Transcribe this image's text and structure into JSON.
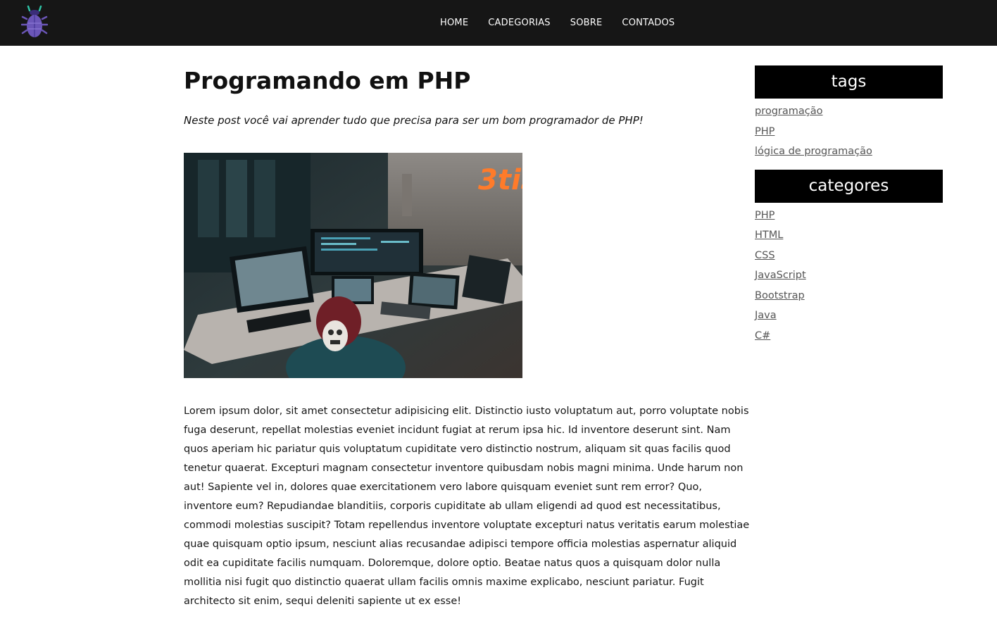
{
  "nav": {
    "logo_icon": "bug-icon",
    "items": [
      {
        "label": "HOME"
      },
      {
        "label": "CADEGORIAS"
      },
      {
        "label": "SOBRE"
      },
      {
        "label": "CONTADOS"
      }
    ]
  },
  "post": {
    "title": "Programando em PHP",
    "subtitle": "Neste post você vai aprender tudo que precisa para ser um bom programador de PHP!",
    "image_alt": "",
    "body": "Lorem ipsum dolor, sit amet consectetur adipisicing elit. Distinctio iusto voluptatum aut, porro voluptate nobis fuga deserunt, repellat molestias eveniet incidunt fugiat at rerum ipsa hic. Id inventore deserunt sint. Nam quos aperiam hic pariatur quis voluptatum cupiditate vero distinctio nostrum, aliquam sit quas facilis quod tenetur quaerat. Excepturi magnam consectetur inventore quibusdam nobis magni minima. Unde harum non aut! Sapiente vel in, dolores quae exercitationem vero labore quisquam eveniet sunt rem error? Quo, inventore eum? Repudiandae blanditiis, corporis cupiditate ab ullam eligendi ad quod est necessitatibus, commodi molestias suscipit? Totam repellendus inventore voluptate excepturi natus veritatis earum molestiae quae quisquam optio ipsum, nesciunt alias recusandae adipisci tempore officia molestias aspernatur aliquid odit ea cupiditate facilis numquam. Doloremque, dolore optio. Beatae natus quos a quisquam dolor nulla mollitia nisi fugit quo distinctio quaerat ullam facilis omnis maxime explicabo, nesciunt pariatur. Fugit architecto sit enim, sequi deleniti sapiente ut ex esse!"
  },
  "sidebar": {
    "tags": {
      "title": "tags",
      "items": [
        "programação",
        "PHP",
        "lógica de programação"
      ]
    },
    "categories": {
      "title": "categores",
      "items": [
        "PHP",
        "HTML",
        "CSS",
        "JavaScript",
        "Bootstrap",
        "Java",
        "C#"
      ]
    }
  },
  "colors": {
    "topbar": "#161616",
    "sidebar_header": "#000000",
    "link": "#555555",
    "logo_body": "#6b56b8",
    "logo_accent": "#2ec4a6"
  }
}
